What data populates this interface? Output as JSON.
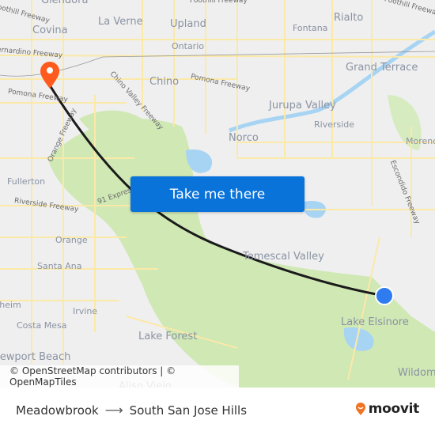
{
  "map": {
    "cities": [
      {
        "name": "Covina",
        "size": "city"
      },
      {
        "name": "La Verne",
        "size": "city"
      },
      {
        "name": "Upland",
        "size": "city"
      },
      {
        "name": "Rialto",
        "size": "city"
      },
      {
        "name": "Fontana",
        "size": "city-sm"
      },
      {
        "name": "Ontario",
        "size": "city"
      },
      {
        "name": "Chino",
        "size": "city"
      },
      {
        "name": "Grand Terrace",
        "size": "city"
      },
      {
        "name": "Jurupa Valley",
        "size": "city"
      },
      {
        "name": "Riverside",
        "size": "city-sm"
      },
      {
        "name": "Norco",
        "size": "city"
      },
      {
        "name": "Moreno",
        "size": "city-sm"
      },
      {
        "name": "Fullerton",
        "size": "city-sm"
      },
      {
        "name": "Orange",
        "size": "city-sm"
      },
      {
        "name": "Santa Ana",
        "size": "city-sm"
      },
      {
        "name": "Temescal Valley",
        "size": "city"
      },
      {
        "name": "Irvine",
        "size": "city-sm"
      },
      {
        "name": "Costa Mesa",
        "size": "city-sm"
      },
      {
        "name": "Lake Forest",
        "size": "city"
      },
      {
        "name": "Lake Elsinore",
        "size": "city"
      },
      {
        "name": "Newport Beach",
        "size": "city"
      },
      {
        "name": "Wildomar",
        "size": "city"
      },
      {
        "name": "Glendora",
        "size": "city"
      },
      {
        "name": "Aliso Viejo",
        "size": "city"
      },
      {
        "name": "Anaheim",
        "size": "city-sm"
      }
    ],
    "roads": [
      {
        "name": "Foothill Freeway"
      },
      {
        "name": "Foothill Freeway"
      },
      {
        "name": "San Bernardino Freeway"
      },
      {
        "name": "Pomona Freeway"
      },
      {
        "name": "Chino Valley Freeway"
      },
      {
        "name": "Pomona Freeway"
      },
      {
        "name": "Orange Freeway"
      },
      {
        "name": "Riverside Freeway"
      },
      {
        "name": "91 Express"
      },
      {
        "name": "Escondido Freeway"
      }
    ],
    "origin_marker": {
      "color": "#2f7cf0"
    },
    "destination_marker": {
      "color": "#fe5a1d"
    },
    "route_line_color": "#1a1a1a",
    "attribution": "© OpenStreetMap contributors | © OpenMapTiles"
  },
  "cta": {
    "label": "Take me there",
    "color": "#0a73d9"
  },
  "footer": {
    "origin": "Meadowbrook",
    "arrow": "⟶",
    "destination": "South San Jose Hills",
    "brand": "moovit",
    "brand_color": "#f27321"
  }
}
